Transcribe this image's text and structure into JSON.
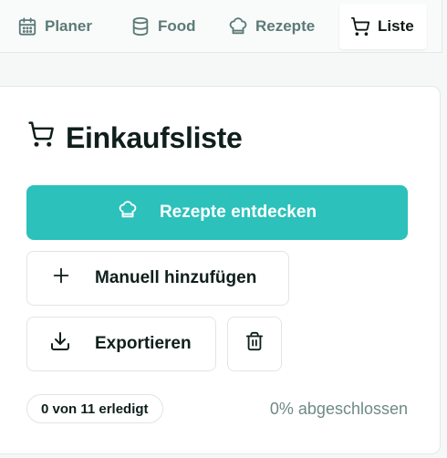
{
  "nav": {
    "items": [
      {
        "label": "Planer",
        "icon": "calendar-icon"
      },
      {
        "label": "Food",
        "icon": "database-icon"
      },
      {
        "label": "Rezepte",
        "icon": "chef-hat-icon"
      },
      {
        "label": "Liste",
        "icon": "cart-icon",
        "active": true
      }
    ]
  },
  "card": {
    "title": "Einkaufsliste",
    "discover_label": "Rezepte entdecken",
    "add_label": "Manuell hinzufügen",
    "export_label": "Exportieren",
    "status_badge": "0 von 11 erledigt",
    "progress_text": "0% abgeschlossen",
    "progress_percent": 0
  },
  "colors": {
    "accent": "#2cc1bb",
    "text": "#0f1f1c",
    "muted": "#5c7a76"
  }
}
